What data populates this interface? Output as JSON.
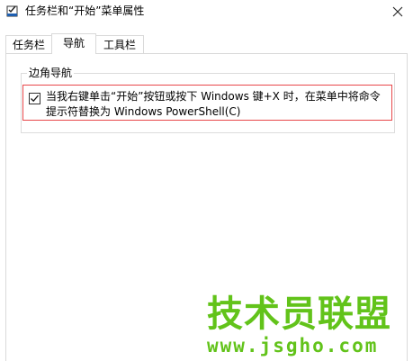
{
  "window": {
    "title": "任务栏和“开始”菜单属性",
    "close_glyph": "✕"
  },
  "tabs": [
    {
      "label": "任务栏"
    },
    {
      "label": "导航",
      "selected": true
    },
    {
      "label": "工具栏"
    }
  ],
  "corner_nav": {
    "legend": "边角导航",
    "powershell_option": {
      "label": "当我右键单击“开始”按钮或按下 Windows 键+X 时，在菜单中将命令提示符替换为 Windows PowerShell(C)",
      "checked": true
    }
  },
  "watermark": {
    "main": "技术员联盟",
    "url": "www.jsgho.com",
    "color": "#62c31a"
  },
  "colors": {
    "highlight_border": "#e8474a",
    "tab_border": "#d9d9d9"
  }
}
